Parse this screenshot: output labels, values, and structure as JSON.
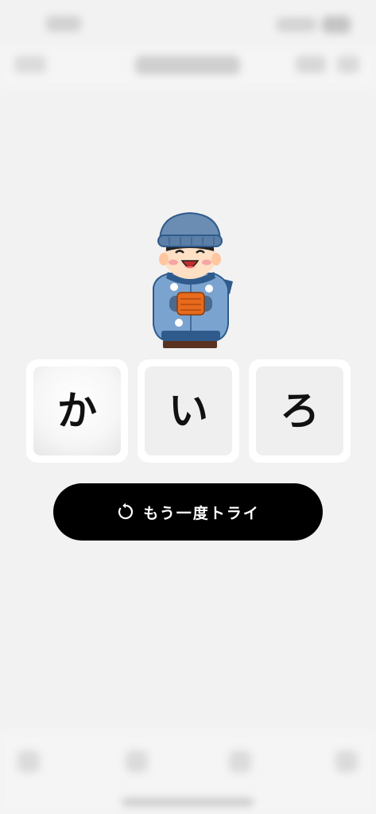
{
  "game": {
    "tiles": [
      {
        "char": "か",
        "selected": true
      },
      {
        "char": "い",
        "selected": false
      },
      {
        "char": "ろ",
        "selected": false
      }
    ],
    "retry_label": "もう一度トライ",
    "retry_icon": "retry-icon"
  },
  "illustration": {
    "icon": "boy-in-winter-clothes-holding-hand-warmer"
  },
  "colors": {
    "background": "#f2f2f2",
    "button": "#000000",
    "button_text": "#ffffff",
    "tile": "#ffffff",
    "tile_inner": "#efefef"
  }
}
